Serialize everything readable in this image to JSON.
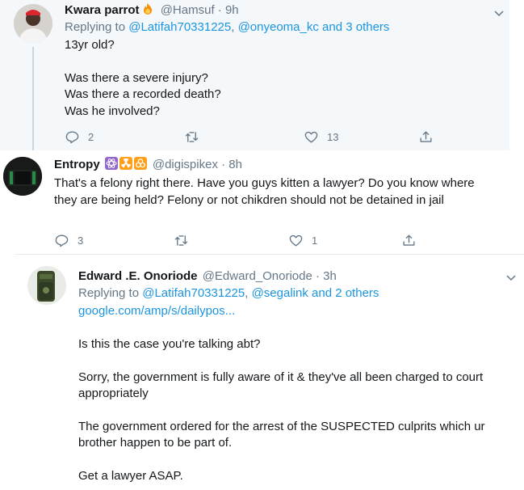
{
  "tweets": [
    {
      "name": "Kwara parrot",
      "name_emoji_icon": "fire-emoji-icon",
      "handle": "@Hamsuf",
      "time": "· 9h",
      "replying_prefix": "Replying to",
      "replying_user": "@Latifah70331225",
      "replying_rest": "@onyeoma_kc and 3 others",
      "paragraphs": [
        "13yr old?",
        "Was there a severe injury?\nWas there a recorded death?\nWas he involved?"
      ],
      "replies": "2",
      "retweets": "",
      "likes": "13"
    },
    {
      "name": "Entropy",
      "name_emoji_icon": "atom-radioactive-biohazard-emoji-icons",
      "handle": "@digispikex",
      "time": "· 8h",
      "paragraphs": [
        "That's a felony right there. Have you guys kitten a lawyer? Do you know where they are being held? Felony or not chikdren should not be detained in jail"
      ],
      "replies": "3",
      "retweets": "",
      "likes": "1"
    },
    {
      "name": "Edward .E. Onoriode",
      "handle": "@Edward_Onoriode",
      "time": "· 3h",
      "replying_prefix": "Replying to",
      "replying_user": "@Latifah70331225",
      "replying_rest": "@segalink and 2 others",
      "link": "google.com/amp/s/dailypos...",
      "paragraphs": [
        "Is this the case you're talking abt?",
        "Sorry, the government is fully aware of it & they've all been charged to court appropriately",
        "The government ordered for the arrest of the SUSPECTED culprits which ur brother happen to be part of.",
        "Get a lawyer ASAP."
      ]
    }
  ],
  "colors": {
    "link": "#1b95e0",
    "muted": "#657786",
    "text": "#14171a",
    "reply_bg": "#f5f8fa"
  }
}
